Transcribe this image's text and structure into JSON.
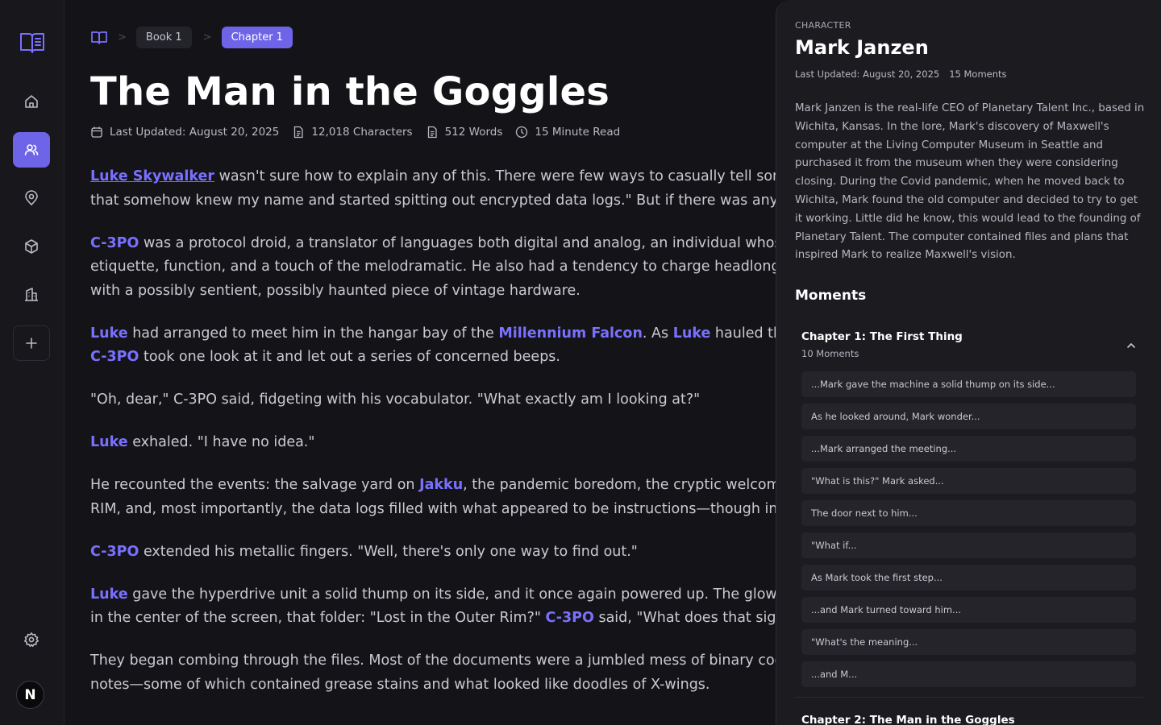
{
  "sidebar": {
    "items": [
      {
        "name": "home-icon"
      },
      {
        "name": "users-icon",
        "active": true
      },
      {
        "name": "map-pin-icon"
      },
      {
        "name": "box-icon"
      },
      {
        "name": "building-icon"
      },
      {
        "name": "plus-icon"
      }
    ],
    "settings_icon": "gear-icon",
    "avatar_letter": "N"
  },
  "breadcrumb": {
    "items": [
      "Book 1",
      "Chapter 1"
    ],
    "separator": ">"
  },
  "chapter": {
    "title": "The Man in the Goggles",
    "meta": {
      "updated": "Last Updated: August 20, 2025",
      "characters": "12,018 Characters",
      "words": "512 Words",
      "read_time": "15 Minute Read"
    }
  },
  "content": {
    "p1": {
      "e1": "Luke Skywalker",
      "t1": " wasn't sure how to explain any of this. There were few ways to casually tell someone,",
      "t2": "that somehow knew my name and started spitting out encrypted data logs.\" But if there was anyone"
    },
    "p2": {
      "e1": "C-3PO",
      "t1": " was a protocol droid, a translator of languages both digital and analog, an individual whose",
      "t2": "etiquette, function, and a touch of the melodramatic. He also had a tendency to charge headlong",
      "t3": "with a possibly sentient, possibly haunted piece of vintage hardware."
    },
    "p3": {
      "e1": "Luke",
      "t1": " had arranged to meet him in the hangar bay of the ",
      "e2": "Millennium Falcon",
      "t2": ". As ",
      "e3": "Luke",
      "t3": " hauled the mysterious",
      "e4": "C-3PO",
      "t4": " took one look at it and let out a series of concerned beeps."
    },
    "p4": "\"Oh, dear,\" C-3PO said, fidgeting with his vocabulator. \"What exactly am I looking at?\"",
    "p5": {
      "e1": "Luke",
      "t1": " exhaled. \"I have no idea.\""
    },
    "p6": {
      "t1": "He recounted the events: the salvage yard on ",
      "e1": "Jakku",
      "t2": ", the pandemic boredom, the cryptic welcome screen,",
      "t3": "RIM, and, most importantly, the data logs filled with what appeared to be instructions—though in"
    },
    "p7": {
      "e1": "C-3PO",
      "t1": " extended his metallic fingers. \"Well, there's only one way to find out.\""
    },
    "p8": {
      "e1": "Luke",
      "t1": " gave the hyperdrive unit a solid thump on its side, and it once again powered up. The glow of",
      "t2": "in the center of the screen, that folder: \"Lost in the Outer Rim?\" ",
      "e2": "C-3PO",
      "t3": " said, \"What does that signify?\""
    },
    "p9": {
      "t1": "They began combing through the files. Most of the documents were a jumbled mess of binary code,",
      "t2": "notes—some of which contained grease stains and what looked like doodles of X-wings."
    }
  },
  "panel": {
    "label": "CHARACTER",
    "name": "Mark Janzen",
    "updated": "Last Updated: August 20, 2025",
    "moment_count": "15 Moments",
    "description": "Mark Janzen is the real-life CEO of Planetary Talent Inc., based in Wichita, Kansas. In the lore, Mark's discovery of Maxwell's computer at the Living Computer Museum in Seattle and purchased it from the museum when they were considering closing. During the Covid pandemic, when he moved back to Wichita, Mark found the old computer and decided to try to get it working. Little did he know, this would lead to the founding of Planetary Talent. The computer contained files and plans that inspired Mark to realize Maxwell's vision.",
    "moments_heading": "Moments",
    "chapters": [
      {
        "title": "Chapter 1: The First Thing",
        "count": "10 Moments",
        "expanded": true,
        "moments": [
          "...Mark gave the machine a solid thump on its side...",
          "As he looked around, Mark wonder...",
          "...Mark arranged the meeting...",
          "\"What is this?\" Mark asked...",
          "The door next to him...",
          "\"What if...",
          "As Mark took the first step...",
          "...and Mark turned toward him...",
          "\"What's the meaning...",
          "...and M..."
        ]
      },
      {
        "title": "Chapter 2: The Man in the Goggles"
      }
    ]
  },
  "colors": {
    "accent": "#6e64e8",
    "entity": "#7a70ff",
    "background": "#141418",
    "panel": "#1b1b20"
  }
}
